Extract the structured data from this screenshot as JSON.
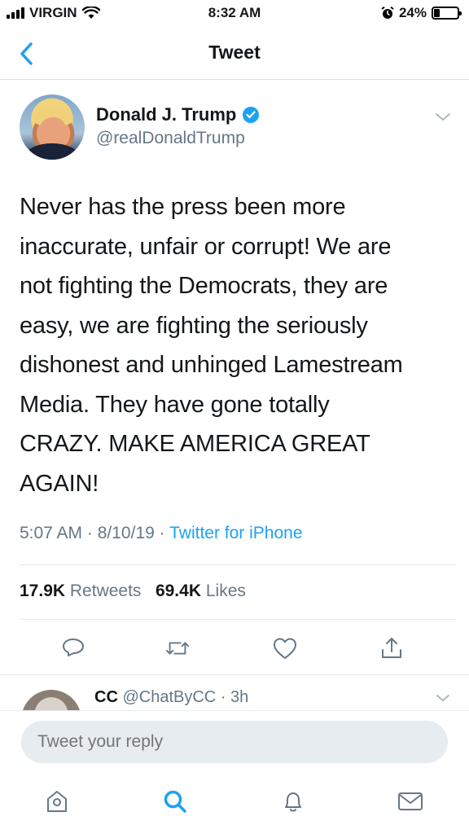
{
  "status_bar": {
    "carrier": "VIRGIN",
    "time": "8:32 AM",
    "battery_percent": "24%",
    "battery_level": 0.24
  },
  "nav": {
    "title": "Tweet",
    "back_icon": "chevron-left-icon"
  },
  "tweet": {
    "author_name": "Donald J. Trump",
    "handle": "@realDonaldTrump",
    "text_lines": [
      "Never has the press been more",
      "inaccurate, unfair or corrupt! We are",
      "not fighting the Democrats, they are",
      "easy, we are fighting the seriously",
      "dishonest and unhinged Lamestream",
      "Media. They have gone totally",
      "CRAZY. MAKE AMERICA GREAT",
      "AGAIN!"
    ],
    "time": "5:07 AM",
    "date": "8/10/19",
    "source": "Twitter for iPhone",
    "retweets_count": "17.9K",
    "retweets_label": "Retweets",
    "likes_count": "69.4K",
    "likes_label": "Likes"
  },
  "reply_preview": {
    "name": "CC",
    "handle": "@ChatByCC",
    "age": "3h"
  },
  "reply_input": {
    "placeholder": "Tweet your reply"
  },
  "colors": {
    "accent": "#1da1f2",
    "secondary_text": "#657786",
    "primary_text": "#14171a"
  }
}
